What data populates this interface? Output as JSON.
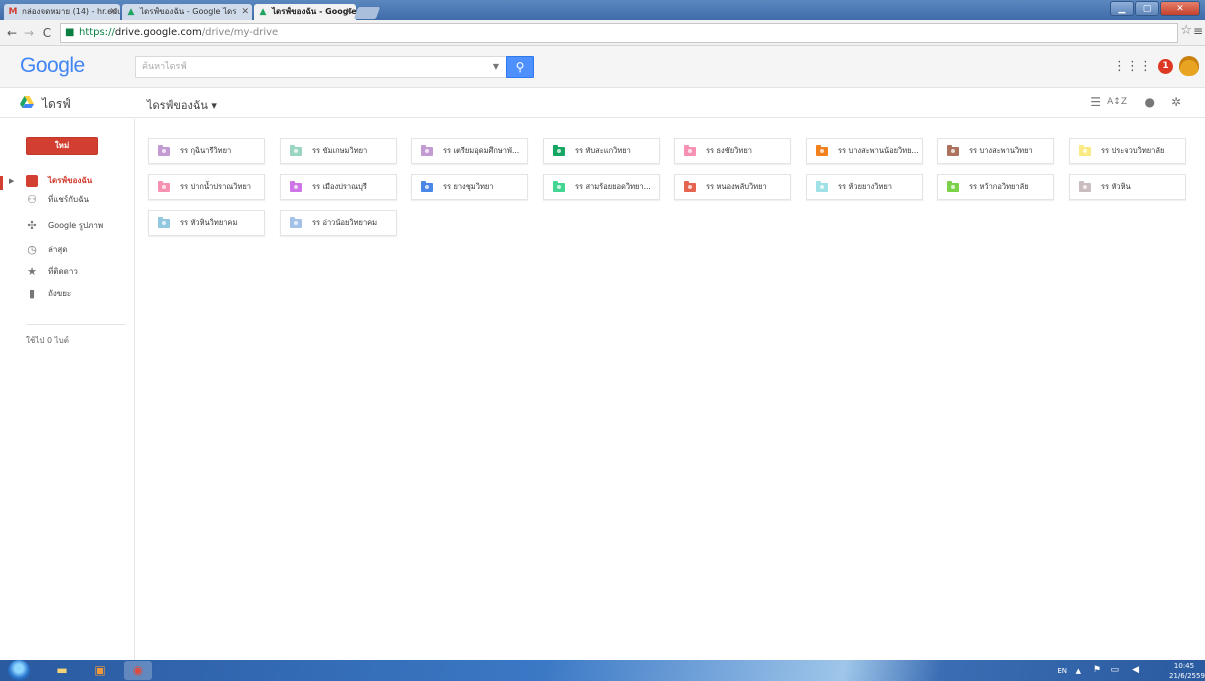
{
  "browser": {
    "tabs": [
      {
        "title": "กล่องจดหมาย (14) - hr.edu",
        "icon": "gmail-icon",
        "color": "#d23f31",
        "active": false
      },
      {
        "title": "ไดรฟ์ของฉัน - Google ไดร",
        "icon": "drive-icon",
        "color": "#1fa463",
        "active": false
      },
      {
        "title": "ไดรฟ์ของฉัน - Google ไดร",
        "icon": "drive-icon",
        "color": "#1fa463",
        "active": true
      }
    ],
    "url_scheme": "https://",
    "url_host": "drive.google.com",
    "url_path": "/drive/my-drive"
  },
  "header": {
    "logo": "Google",
    "search_placeholder": "ค้นหาไดรฟ์",
    "notification_count": "1"
  },
  "subbar": {
    "app_title": "ไดรฟ์",
    "location": "ไดรฟ์ของฉัน ▾"
  },
  "sidebar": {
    "new_button": "ใหม่",
    "items": [
      {
        "label": "ไดรฟ์ของฉัน",
        "icon": "folder-icon",
        "active": true
      },
      {
        "label": "ที่แชร์กับฉัน",
        "icon": "shared-people-icon",
        "active": false
      },
      {
        "label": "Google รูปภาพ",
        "icon": "photos-pinwheel-icon",
        "active": false
      },
      {
        "label": "ล่าสุด",
        "icon": "clock-icon",
        "active": false
      },
      {
        "label": "ที่ติดดาว",
        "icon": "star-icon",
        "active": false
      },
      {
        "label": "ถังขยะ",
        "icon": "trash-icon",
        "active": false
      }
    ],
    "storage": "ใช้ไป 0 ไบต์"
  },
  "folders": [
    {
      "name": "รร กุฉินารีวิทยา",
      "color": "#c39bd3"
    },
    {
      "name": "รร ขัมเกษมวิทยา",
      "color": "#9ad6c0"
    },
    {
      "name": "รร เตรียมอุดมศึกษาพั...",
      "color": "#c39bd3"
    },
    {
      "name": "รร ทับสะแกวิทยา",
      "color": "#16a765"
    },
    {
      "name": "รร ธงชัยวิทยา",
      "color": "#f691b2"
    },
    {
      "name": "รร บางสะพานน้อยวิทย...",
      "color": "#f2811d"
    },
    {
      "name": "รร บางสะพานวิทยา",
      "color": "#ac725e"
    },
    {
      "name": "รร ประจวบวิทยาลัย",
      "color": "#fbe983"
    },
    {
      "name": "รร ปากน้ำปราณวิทยา",
      "color": "#f691b2"
    },
    {
      "name": "รร เมืองปราณบุรี",
      "color": "#cd74e6"
    },
    {
      "name": "รร ยางชุมวิทยา",
      "color": "#4986e7"
    },
    {
      "name": "รร สามร้อยยอดวิทยา...",
      "color": "#42d692"
    },
    {
      "name": "รร หนองพลับวิทยา",
      "color": "#e66550"
    },
    {
      "name": "รร ห้วยยางวิทยา",
      "color": "#9fe1e7"
    },
    {
      "name": "รร หว้ากอวิทยาลัย",
      "color": "#7bd148"
    },
    {
      "name": "รร หัวหิน",
      "color": "#cabdbf"
    },
    {
      "name": "รร หัวหินวิทยาคม",
      "color": "#92c7e0"
    },
    {
      "name": "รร อ่าวน้อยวิทยาคม",
      "color": "#a4c2e8"
    }
  ],
  "taskbar": {
    "lang": "EN",
    "time": "10:45",
    "date": "21/6/2559"
  }
}
